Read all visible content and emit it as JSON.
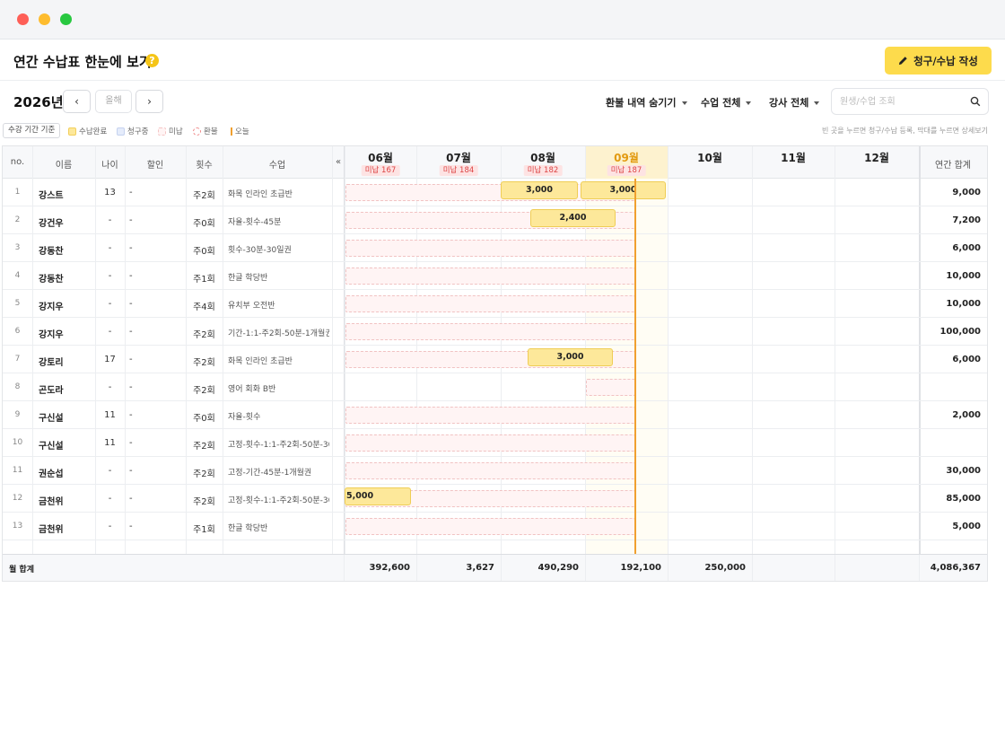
{
  "app": {
    "title": "연간 수납표 한눈에 보기",
    "help_icon": "question-circle-icon",
    "primary_button": "청구/수납 작성",
    "primary_icon": "pencil-icon"
  },
  "toolbar": {
    "year": "2026년",
    "prev_icon": "chevron-left-icon",
    "next_icon": "chevron-right-icon",
    "this_year": "올해",
    "filters": [
      "환불 내역 숨기기",
      "수업 전체",
      "강사 전체"
    ],
    "search_placeholder": "원생/수업 조회"
  },
  "legend": {
    "period_button": "수강 기간 기준",
    "items": [
      "수납완료",
      "청구중",
      "미납",
      "환불",
      "오늘"
    ],
    "hint": "빈 곳을 누르면 청구/수납 등록, 막대를 누르면 상세보기"
  },
  "table": {
    "headers": {
      "no": "no.",
      "name": "이름",
      "age": "나이",
      "discount": "할인",
      "count": "횟수",
      "class": "수업",
      "collapse": "«",
      "total": "연간 합계"
    },
    "months": [
      {
        "label": "06월",
        "badge": "미납 167"
      },
      {
        "label": "07월",
        "badge": "미납 184"
      },
      {
        "label": "08월",
        "badge": "미납 182"
      },
      {
        "label": "09월",
        "badge": "미납 187",
        "current": true
      },
      {
        "label": "10월",
        "badge": ""
      },
      {
        "label": "11월",
        "badge": ""
      },
      {
        "label": "12월",
        "badge": ""
      }
    ],
    "rows": [
      {
        "no": "1",
        "name": "강스트",
        "age": "13",
        "discount": "-",
        "count": "주2회",
        "class": "화목 인라인 초급반",
        "total": "9,000"
      },
      {
        "no": "2",
        "name": "강건우",
        "age": "-",
        "discount": "-",
        "count": "주0회",
        "class": "자율-횟수-45분",
        "total": "7,200"
      },
      {
        "no": "3",
        "name": "강동찬",
        "age": "-",
        "discount": "-",
        "count": "주0회",
        "class": "횟수-30분-30일권",
        "total": "6,000"
      },
      {
        "no": "4",
        "name": "강동찬",
        "age": "-",
        "discount": "-",
        "count": "주1회",
        "class": "한글 학당반",
        "total": "10,000"
      },
      {
        "no": "5",
        "name": "강지우",
        "age": "-",
        "discount": "-",
        "count": "주4회",
        "class": "유치부 오전반",
        "total": "10,000"
      },
      {
        "no": "6",
        "name": "강지우",
        "age": "-",
        "discount": "-",
        "count": "주2회",
        "class": "기간-1:1-주2회-50분-1개월권",
        "total": "100,000"
      },
      {
        "no": "7",
        "name": "강토리",
        "age": "17",
        "discount": "-",
        "count": "주2회",
        "class": "화목 인라인 초급반",
        "total": "6,000"
      },
      {
        "no": "8",
        "name": "곤도라",
        "age": "-",
        "discount": "-",
        "count": "주2회",
        "class": "영어 회화 B반",
        "total": ""
      },
      {
        "no": "9",
        "name": "구신설",
        "age": "11",
        "discount": "-",
        "count": "주0회",
        "class": "자율-횟수",
        "total": "2,000"
      },
      {
        "no": "10",
        "name": "구신설",
        "age": "11",
        "discount": "-",
        "count": "주2회",
        "class": "고정-횟수-1:1-주2회-50분-30...",
        "total": ""
      },
      {
        "no": "11",
        "name": "권순섭",
        "age": "-",
        "discount": "-",
        "count": "주2회",
        "class": "고정-기간-45분-1개월권",
        "total": "30,000"
      },
      {
        "no": "12",
        "name": "금천위",
        "age": "-",
        "discount": "-",
        "count": "주2회",
        "class": "고정-횟수-1:1-주2회-50분-30...",
        "total": "85,000"
      },
      {
        "no": "13",
        "name": "금천위",
        "age": "-",
        "discount": "-",
        "count": "주1회",
        "class": "한글 학당반",
        "total": "5,000"
      }
    ],
    "paid_blocks": [
      {
        "row": 0,
        "label": "3,000"
      },
      {
        "row": 0,
        "label": "3,000"
      },
      {
        "row": 1,
        "label": "2,400"
      },
      {
        "row": 6,
        "label": "3,000"
      },
      {
        "row": 11,
        "label": "5,000"
      }
    ],
    "footer": {
      "label": "월 합계",
      "months": [
        "392,600",
        "3,627",
        "490,290",
        "192,100",
        "250,000",
        "",
        ""
      ],
      "total": "4,086,367"
    }
  }
}
